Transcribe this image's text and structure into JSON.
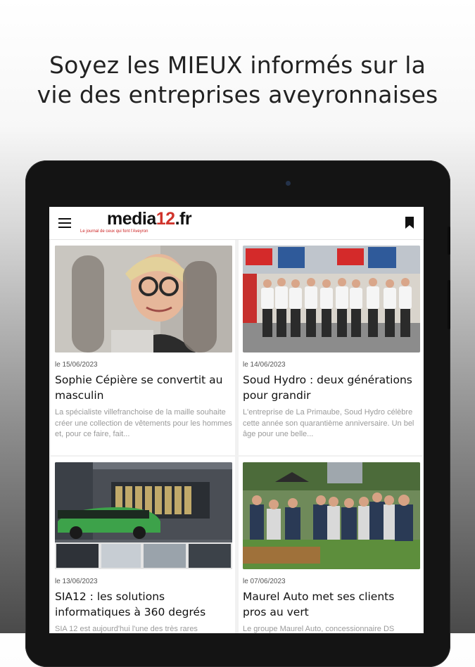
{
  "promo": {
    "headline_line1": "Soyez les MIEUX informés sur la",
    "headline_line2": "vie des entreprises aveyronnaises"
  },
  "app": {
    "logo_main": "media",
    "logo_accent": "12",
    "logo_tld": ".fr",
    "tagline": "Le journal de ceux qui font l'Aveyron",
    "menu_icon": "hamburger-menu-icon",
    "bookmark_icon": "bookmark-icon",
    "accent_color": "#d0342c"
  },
  "articles": [
    {
      "date": "le 15/06/2023",
      "title": "Sophie Cépière se convertit au masculin",
      "excerpt": "La spécialiste villefranchoise de la maille souhaite créer une collection de vêtements pour les hommes et, pour ce faire, fait..."
    },
    {
      "date": "le 14/06/2023",
      "title": "Soud Hydro : deux générations pour grandir",
      "excerpt": "L'entreprise de La Primaube, Soud Hydro célèbre cette année son quarantième anniversaire. Un bel âge pour une belle..."
    },
    {
      "date": "le 13/06/2023",
      "title": "SIA12 : les solutions informatiques à 360 degrés",
      "excerpt": "SIA 12 est aujourd'hui l'une des très rares"
    },
    {
      "date": "le 07/06/2023",
      "title": "Maurel Auto met ses clients pros au vert",
      "excerpt": "Le groupe Maurel Auto, concessionnaire DS"
    }
  ]
}
